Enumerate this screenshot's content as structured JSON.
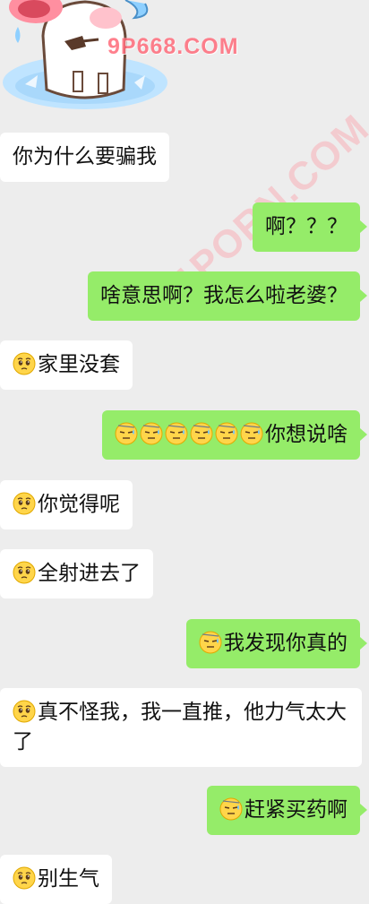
{
  "colors": {
    "background": "#ededed",
    "sent_bubble": "#95ec69",
    "received_bubble": "#ffffff",
    "watermark": "#ff7b86"
  },
  "watermarks": {
    "top": "9P668.COM",
    "diagonal": "91PORN.COM"
  },
  "sticker": {
    "icon": "crying-cartoon-sticker"
  },
  "messages": [
    {
      "side": "left",
      "emoji": [],
      "text": "你为什么要骗我"
    },
    {
      "side": "right",
      "emoji": [],
      "text": "啊？？？"
    },
    {
      "side": "right",
      "emoji": [],
      "text": "啥意思啊？我怎么啦老婆？"
    },
    {
      "side": "left",
      "emoji": [
        "pleading-face-icon"
      ],
      "text": "家里没套"
    },
    {
      "side": "right",
      "emoji": [
        "sweat-face-icon",
        "sweat-face-icon",
        "sweat-face-icon",
        "sweat-face-icon",
        "sweat-face-icon",
        "sweat-face-icon"
      ],
      "text": "你想说啥"
    },
    {
      "side": "left",
      "emoji": [
        "pleading-face-icon"
      ],
      "text": "你觉得呢"
    },
    {
      "side": "left",
      "emoji": [
        "pleading-face-icon"
      ],
      "text": "全射进去了"
    },
    {
      "side": "right",
      "emoji": [
        "sweat-face-icon"
      ],
      "text": "我发现你真的"
    },
    {
      "side": "left",
      "emoji": [
        "pleading-face-icon"
      ],
      "text": "真不怪我，我一直推，他力气太大了"
    },
    {
      "side": "right",
      "emoji": [
        "sweat-face-icon"
      ],
      "text": "赶紧买药啊"
    },
    {
      "side": "left",
      "emoji": [
        "pleading-face-icon"
      ],
      "text": "别生气"
    }
  ]
}
